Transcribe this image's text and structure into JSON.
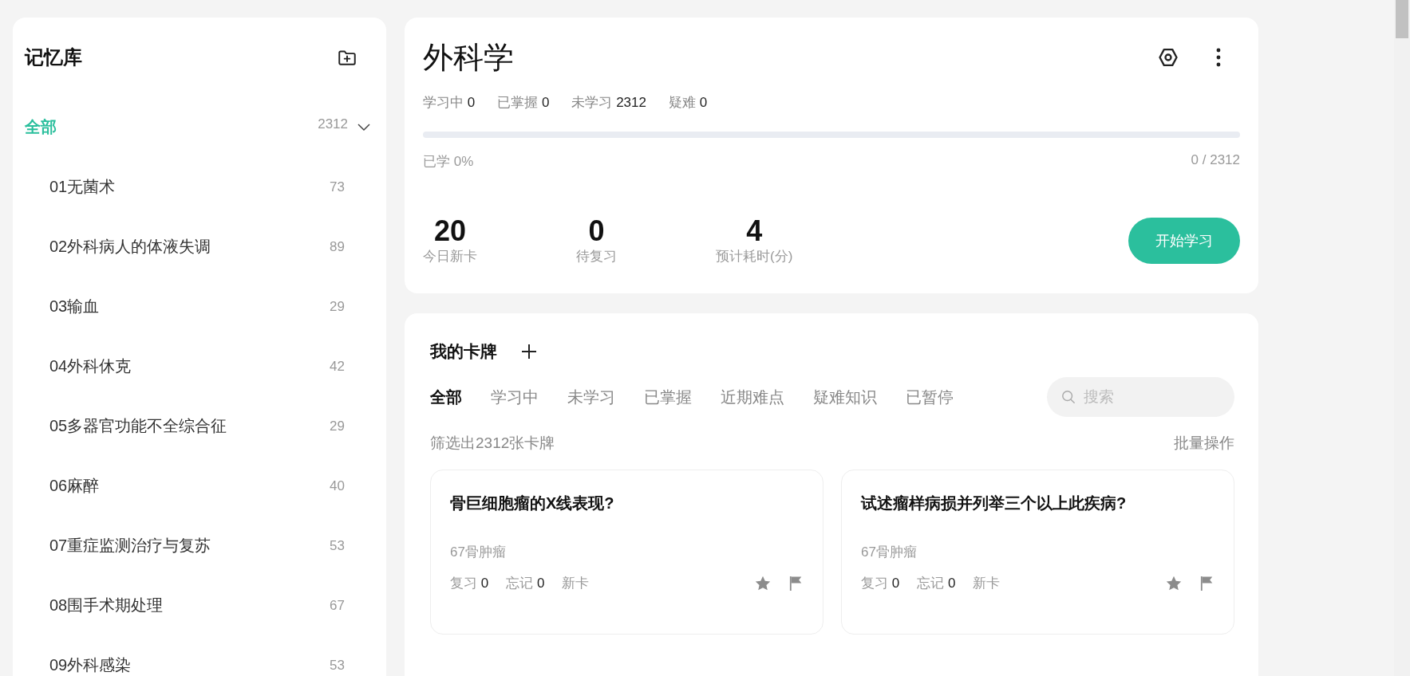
{
  "sidebar": {
    "title": "记忆库",
    "all": {
      "label": "全部",
      "count": "2312",
      "selected": true,
      "expanded": true
    },
    "items": [
      {
        "label": "01无菌术",
        "count": "73",
        "selected": false
      },
      {
        "label": "02外科病人的体液失调",
        "count": "89",
        "selected": false
      },
      {
        "label": "03输血",
        "count": "29",
        "selected": false
      },
      {
        "label": "04外科休克",
        "count": "42",
        "selected": false
      },
      {
        "label": "05多器官功能不全综合征",
        "count": "29",
        "selected": false
      },
      {
        "label": "06麻醉",
        "count": "40",
        "selected": false
      },
      {
        "label": "07重症监测治疗与复苏",
        "count": "53",
        "selected": false
      },
      {
        "label": "08围手术期处理",
        "count": "67",
        "selected": false
      },
      {
        "label": "09外科感染",
        "count": "53",
        "selected": false
      }
    ]
  },
  "deck": {
    "title": "外科学",
    "stats": [
      {
        "label": "学习中",
        "value": "0"
      },
      {
        "label": "已掌握",
        "value": "0"
      },
      {
        "label": "未学习",
        "value": "2312"
      },
      {
        "label": "疑难",
        "value": "0"
      }
    ],
    "progress": {
      "level": 0,
      "label": "已学 0%",
      "count": "0 / 2312"
    },
    "metrics": [
      {
        "value": "20",
        "label": "今日新卡"
      },
      {
        "value": "0",
        "label": "待复习"
      },
      {
        "value": "4",
        "label": "预计耗时(分)"
      }
    ],
    "start_button": "开始学习"
  },
  "cards_section": {
    "title": "我的卡牌",
    "tabs": [
      {
        "label": "全部",
        "selected": true
      },
      {
        "label": "学习中",
        "selected": false
      },
      {
        "label": "未学习",
        "selected": false
      },
      {
        "label": "已掌握",
        "selected": false
      },
      {
        "label": "近期难点",
        "selected": false
      },
      {
        "label": "疑难知识",
        "selected": false
      },
      {
        "label": "已暂停",
        "selected": false
      }
    ],
    "search": {
      "placeholder": "搜索"
    },
    "filter_text": "筛选出2312张卡牌",
    "batch_action": "批量操作",
    "cards": [
      {
        "question": "骨巨细胞瘤的X线表现?",
        "deck": "67骨肿瘤",
        "stats": [
          {
            "label": "复习",
            "value": "0"
          },
          {
            "label": "忘记",
            "value": "0"
          }
        ],
        "status": "新卡"
      },
      {
        "question": "试述瘤样病损并列举三个以上此疾病?",
        "deck": "67骨肿瘤",
        "stats": [
          {
            "label": "复习",
            "value": "0"
          },
          {
            "label": "忘记",
            "value": "0"
          }
        ],
        "status": "新卡"
      }
    ]
  }
}
